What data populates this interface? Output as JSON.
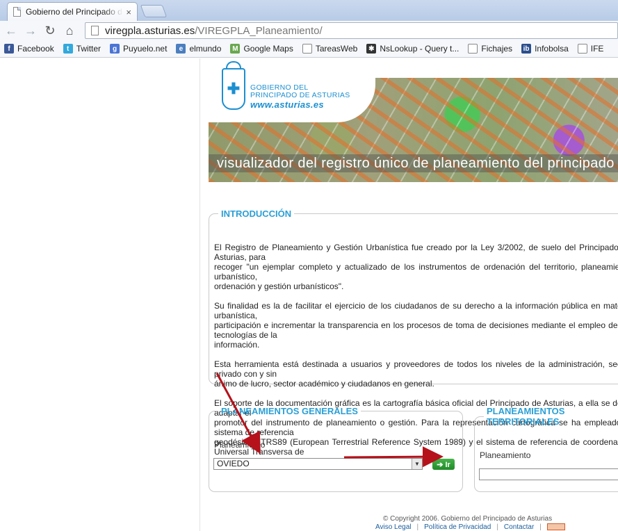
{
  "browser": {
    "tab_title": "Gobierno del Principado de Asturias",
    "tab_close": "×",
    "back": "←",
    "forward": "→",
    "reload": "↻",
    "home": "⌂",
    "url_host": "viregpla.asturias.es",
    "url_path": "/VIREGPLA_Planeamiento/"
  },
  "bookmarks": [
    {
      "label": "Facebook",
      "icon": "facebook-icon",
      "glyph": "f",
      "color": "#3b5998"
    },
    {
      "label": "Twitter",
      "icon": "twitter-icon",
      "glyph": "t",
      "color": "#33a9dc"
    },
    {
      "label": "Puyuelo.net",
      "icon": "google-icon",
      "glyph": "g",
      "color": "#4a74d6"
    },
    {
      "label": "elmundo",
      "icon": "globe-icon",
      "glyph": "e",
      "color": "#4b7fbf"
    },
    {
      "label": "Google Maps",
      "icon": "map-icon",
      "glyph": "M",
      "color": "#6aa84f"
    },
    {
      "label": "TareasWeb",
      "icon": "page-icon",
      "glyph": "",
      "color": "#ffffff"
    },
    {
      "label": "NsLookup - Query t...",
      "icon": "star-icon",
      "glyph": "✱",
      "color": "#333333"
    },
    {
      "label": "Fichajes",
      "icon": "page-icon",
      "glyph": "",
      "color": "#ffffff"
    },
    {
      "label": "Infobolsa",
      "icon": "infobolsa-icon",
      "glyph": "ib",
      "color": "#2c4f8c"
    },
    {
      "label": "IFE",
      "icon": "page-icon",
      "glyph": "",
      "color": "#ffffff"
    }
  ],
  "banner": {
    "gov_line1": "GOBIERNO DEL",
    "gov_line2": "PRINCIPADO DE ASTURIAS",
    "gov_url": "www.asturias.es",
    "caption": "visualizador del registro único de planeamiento del principado"
  },
  "intro": {
    "legend": "INTRODUCCIÓN",
    "paragraphs": [
      "El Registro de Planeamiento y Gestión Urbanística fue creado por la Ley 3/2002, de suelo del Principado de Asturias, para\nrecoger \"un ejemplar completo y actualizado de los instrumentos de ordenación del territorio, planeamiento urbanístico,\nordenación y gestión urbanísticos\".",
      "Su finalidad es la de facilitar el ejercicio de los ciudadanos de su derecho a la información pública en materia urbanística,\nparticipación e incrementar la transparencia en los procesos de toma de decisiones mediante el empleo de las tecnologías de la\ninformación.",
      "Esta herramienta está destinada a usuarios y proveedores de todos los niveles de la administración, sector privado con y sin\nánimo de lucro, sector académico y ciudadanos en general.",
      "El soporte de la documentación gráfica es la cartografía básica oficial del Principado de Asturias, a ella se debe adaptar el\npromotor del instrumento de planeamiento o gestión. Para la representación cartográfica se ha empleado el sistema de referencia\ngeodésico ETRS89 (European Terrestrial Reference System 1989) y el sistema de referencia de coordenadas Universal Transversa de\nMercator."
    ]
  },
  "generales": {
    "legend": "PLANEAMIENTOS GENERALES",
    "label": "Planeamiento",
    "selected": "OVIEDO",
    "go_label": "➔ Ir"
  },
  "territoriales": {
    "legend": "PLANEAMIENTOS TERRITORIALES",
    "label": "Planeamiento",
    "selected": ""
  },
  "footer": {
    "copyright": "© Copyright 2006. Gobierno del Principado de Asturias",
    "aviso": "Aviso Legal",
    "privacidad": "Política de Privacidad",
    "contactar": "Contactar",
    "sep": "|"
  },
  "colors": {
    "accent_blue": "#2a9fd6",
    "go_green": "#2e9e35",
    "arrow_red": "#b5121b"
  }
}
